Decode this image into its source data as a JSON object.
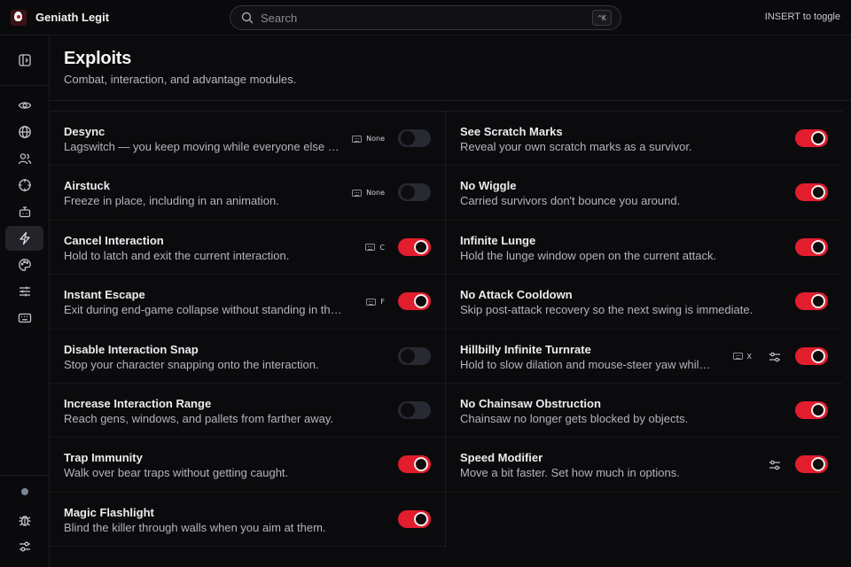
{
  "app": {
    "title": "Geniath Legit"
  },
  "search": {
    "placeholder": "Search",
    "shortcut": "^K"
  },
  "toggle_hint": "INSERT to toggle",
  "accent_color": "#e11d2e",
  "sidebar": {
    "items": [
      {
        "icon": "panel-toggle-icon",
        "active": false
      },
      {
        "icon": "eye-icon",
        "active": false
      },
      {
        "icon": "globe-icon",
        "active": false
      },
      {
        "icon": "users-icon",
        "active": false
      },
      {
        "icon": "crosshair-icon",
        "active": false
      },
      {
        "icon": "robot-icon",
        "active": false
      },
      {
        "icon": "lightning-icon",
        "active": true
      },
      {
        "icon": "palette-icon",
        "active": false
      },
      {
        "icon": "sliders-icon",
        "active": false
      },
      {
        "icon": "keyboard-icon",
        "active": false
      }
    ],
    "bottom": [
      {
        "icon": "status-dot"
      },
      {
        "icon": "bug-icon"
      },
      {
        "icon": "settings-sliders-icon"
      }
    ]
  },
  "page": {
    "title": "Exploits",
    "subtitle": "Combat, interaction, and advantage modules."
  },
  "modules_left": [
    {
      "title": "Desync",
      "desc": "Lagswitch — you keep moving while everyone else …",
      "keybind": "None",
      "on": false,
      "options": false
    },
    {
      "title": "Airstuck",
      "desc": "Freeze in place, including in an animation.",
      "keybind": "None",
      "on": false,
      "options": false
    },
    {
      "title": "Cancel Interaction",
      "desc": "Hold to latch and exit the current interaction.",
      "keybind": "C",
      "on": true,
      "options": false
    },
    {
      "title": "Instant Escape",
      "desc": "Exit during end-game collapse without standing in the…",
      "keybind": "F",
      "on": true,
      "options": false
    },
    {
      "title": "Disable Interaction Snap",
      "desc": "Stop your character snapping onto the interaction.",
      "keybind": null,
      "on": false,
      "options": false
    },
    {
      "title": "Increase Interaction Range",
      "desc": "Reach gens, windows, and pallets from farther away.",
      "keybind": null,
      "on": false,
      "options": false
    },
    {
      "title": "Trap Immunity",
      "desc": "Walk over bear traps without getting caught.",
      "keybind": null,
      "on": true,
      "options": false
    },
    {
      "title": "Magic Flashlight",
      "desc": "Blind the killer through walls when you aim at them.",
      "keybind": null,
      "on": true,
      "options": false
    }
  ],
  "modules_right": [
    {
      "title": "See Scratch Marks",
      "desc": "Reveal your own scratch marks as a survivor.",
      "keybind": null,
      "on": true,
      "options": false
    },
    {
      "title": "No Wiggle",
      "desc": "Carried survivors don't bounce you around.",
      "keybind": null,
      "on": true,
      "options": false
    },
    {
      "title": "Infinite Lunge",
      "desc": "Hold the lunge window open on the current attack.",
      "keybind": null,
      "on": true,
      "options": false
    },
    {
      "title": "No Attack Cooldown",
      "desc": "Skip post-attack recovery so the next swing is immediate.",
      "keybind": null,
      "on": true,
      "options": false
    },
    {
      "title": "Hillbilly Infinite Turnrate",
      "desc": "Hold to slow dilation and mouse-steer yaw whil…",
      "keybind": "X",
      "on": true,
      "options": true
    },
    {
      "title": "No Chainsaw Obstruction",
      "desc": "Chainsaw no longer gets blocked by objects.",
      "keybind": null,
      "on": true,
      "options": false
    },
    {
      "title": "Speed Modifier",
      "desc": "Move a bit faster. Set how much in options.",
      "keybind": null,
      "on": true,
      "options": true
    }
  ]
}
